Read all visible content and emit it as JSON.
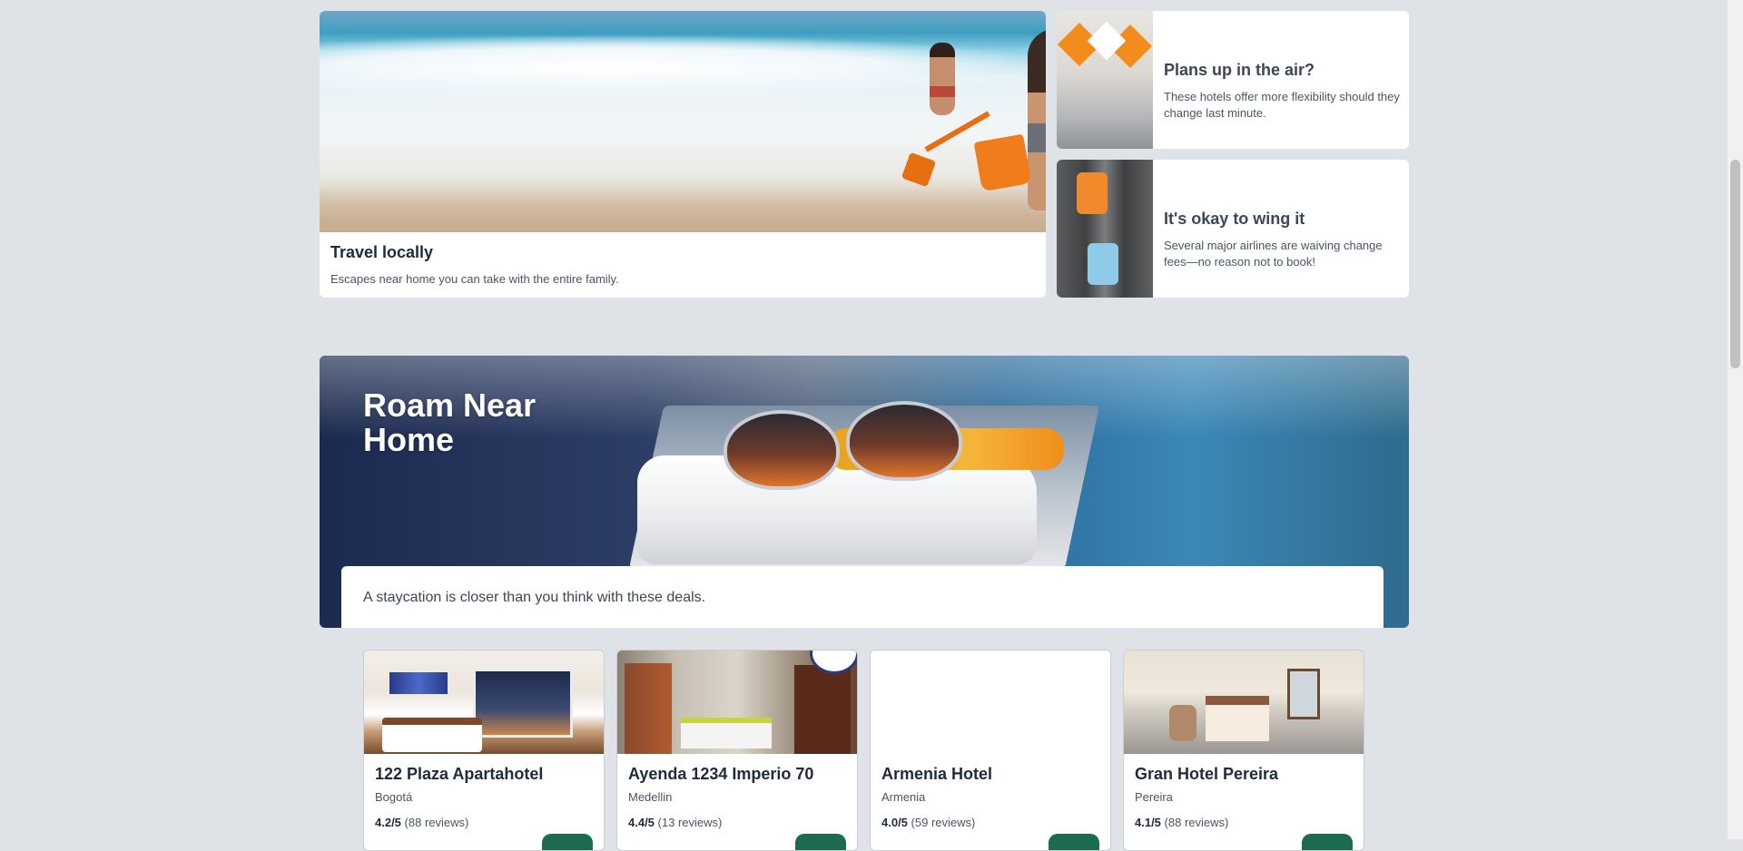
{
  "featured": {
    "main": {
      "title": "Travel locally",
      "subtitle": "Escapes near home you can take with the entire family."
    },
    "side": [
      {
        "title": "Plans up in the air?",
        "subtitle": "These hotels offer more flexibility should they change last minute."
      },
      {
        "title": "It's okay to wing it",
        "subtitle": "Several major airlines are waiving change fees—no reason not to book!"
      }
    ]
  },
  "banner": {
    "title": "Roam Near Home",
    "description": "A staycation is closer than you think with these deals."
  },
  "hotels": [
    {
      "name": "122 Plaza Apartahotel",
      "city": "Bogotá",
      "rating": "4.2/5",
      "reviews": "(88 reviews)"
    },
    {
      "name": "Ayenda 1234 Imperio 70",
      "city": "Medellin",
      "rating": "4.4/5",
      "reviews": "(13 reviews)"
    },
    {
      "name": "Armenia Hotel",
      "city": "Armenia",
      "rating": "4.0/5",
      "reviews": "(59 reviews)"
    },
    {
      "name": "Gran Hotel Pereira",
      "city": "Pereira",
      "rating": "4.1/5",
      "reviews": "(88 reviews)"
    }
  ],
  "colors": {
    "background": "#dfe3e8",
    "card": "#ffffff",
    "text": "#1f2b3a",
    "accent_button": "#1b6b4f"
  }
}
